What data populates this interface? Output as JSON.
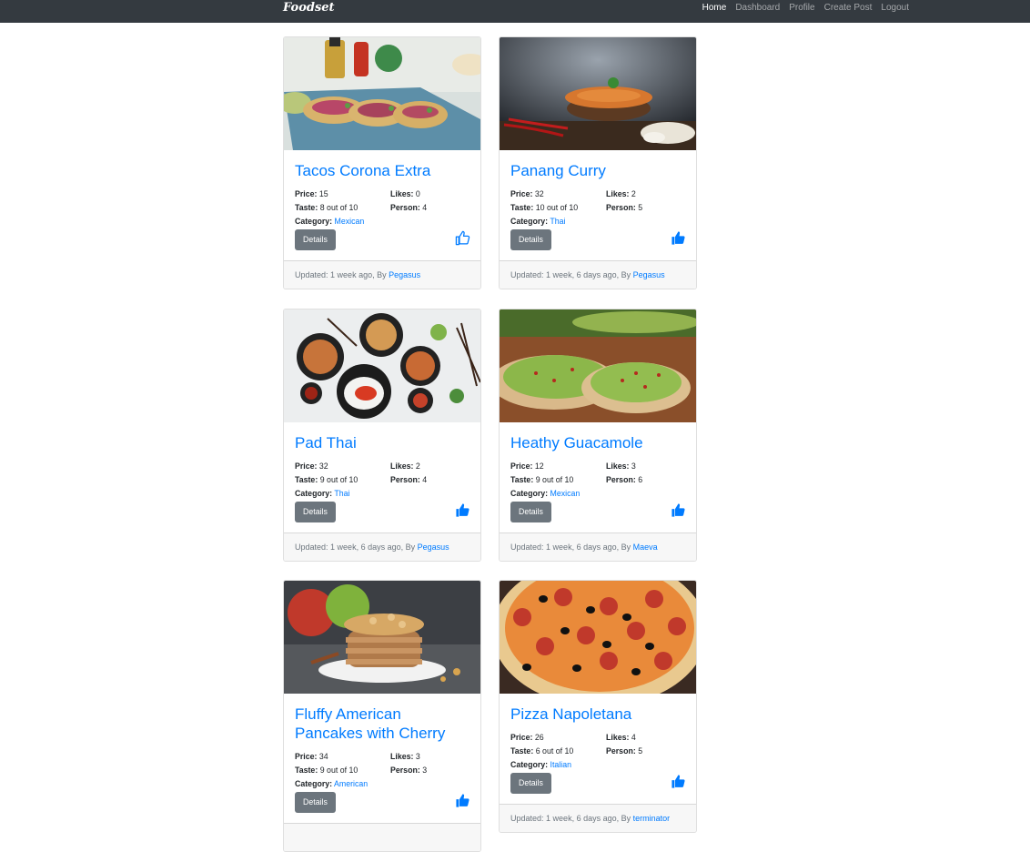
{
  "brand": "Foodset",
  "nav": [
    {
      "label": "Home",
      "active": true
    },
    {
      "label": "Dashboard",
      "active": false
    },
    {
      "label": "Profile",
      "active": false
    },
    {
      "label": "Create Post",
      "active": false
    },
    {
      "label": "Logout",
      "active": false
    }
  ],
  "labels": {
    "price": "Price:",
    "likes": "Likes:",
    "taste": "Taste:",
    "person": "Person:",
    "category": "Category:",
    "details": "Details",
    "updated": "Updated:",
    "by": ", By"
  },
  "posts": [
    {
      "title": "Tacos Corona Extra",
      "price": "15",
      "likes": "0",
      "taste": "8 out of 10",
      "person": "4",
      "category": "Mexican",
      "updated": "1 week ago",
      "author": "Pegasus",
      "liked": false,
      "image": "tacos"
    },
    {
      "title": "Panang Curry",
      "price": "32",
      "likes": "2",
      "taste": "10 out of 10",
      "person": "5",
      "category": "Thai",
      "updated": "1 week, 6 days ago",
      "author": "Pegasus",
      "liked": true,
      "image": "curry"
    },
    {
      "title": "Pad Thai",
      "price": "32",
      "likes": "2",
      "taste": "9 out of 10",
      "person": "4",
      "category": "Thai",
      "updated": "1 week, 6 days ago",
      "author": "Pegasus",
      "liked": true,
      "image": "padthai"
    },
    {
      "title": "Heathy Guacamole",
      "price": "12",
      "likes": "3",
      "taste": "9 out of 10",
      "person": "6",
      "category": "Mexican",
      "updated": "1 week, 6 days ago",
      "author": "Maeva",
      "liked": true,
      "image": "guacamole"
    },
    {
      "title": "Fluffy American Pancakes with Cherry",
      "price": "34",
      "likes": "3",
      "taste": "9 out of 10",
      "person": "3",
      "category": "American",
      "updated": "",
      "author": "",
      "liked": true,
      "image": "pancakes"
    },
    {
      "title": "Pizza Napoletana",
      "price": "26",
      "likes": "4",
      "taste": "6 out of 10",
      "person": "5",
      "category": "Italian",
      "updated": "1 week, 6 days ago",
      "author": "terminator",
      "liked": true,
      "image": "pizza"
    }
  ],
  "colors": {
    "navbar": "#343a40",
    "link": "#007bff",
    "button": "#6c757d"
  }
}
